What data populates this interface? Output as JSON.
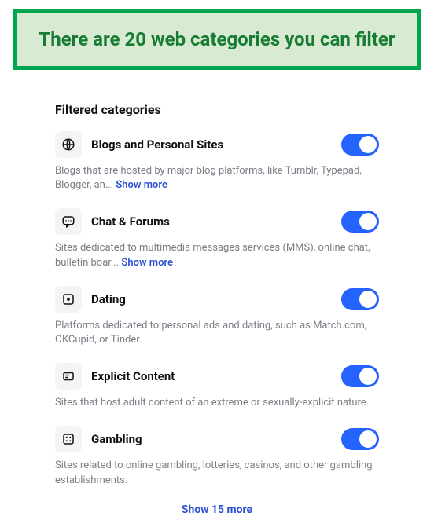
{
  "callout": {
    "text": "There are 20 web categories you can filter"
  },
  "section": {
    "title": "Filtered categories"
  },
  "categories": [
    {
      "icon": "globe-icon",
      "title": "Blogs and Personal Sites",
      "description": "Blogs that are hosted by major blog platforms, like Tumblr, Typepad, Blogger, an... ",
      "show_more": "Show more",
      "has_show_more": true
    },
    {
      "icon": "chat-icon",
      "title": "Chat & Forums",
      "description": "Sites dedicated to multimedia messages services (MMS), online chat, bulletin boar... ",
      "show_more": "Show more",
      "has_show_more": true
    },
    {
      "icon": "dating-icon",
      "title": "Dating",
      "description": "Platforms dedicated to personal ads and dating, such as Match.com, OKCupid, or Tinder.",
      "show_more": "",
      "has_show_more": false
    },
    {
      "icon": "explicit-icon",
      "title": "Explicit Content",
      "description": "Sites that host adult content of an extreme or sexually-explicit nature.",
      "show_more": "",
      "has_show_more": false
    },
    {
      "icon": "gambling-icon",
      "title": "Gambling",
      "description": "Sites related to online gambling, lotteries, casinos, and other gambling establishments.",
      "show_more": "",
      "has_show_more": false
    }
  ],
  "footer": {
    "show_more": "Show 15 more"
  }
}
